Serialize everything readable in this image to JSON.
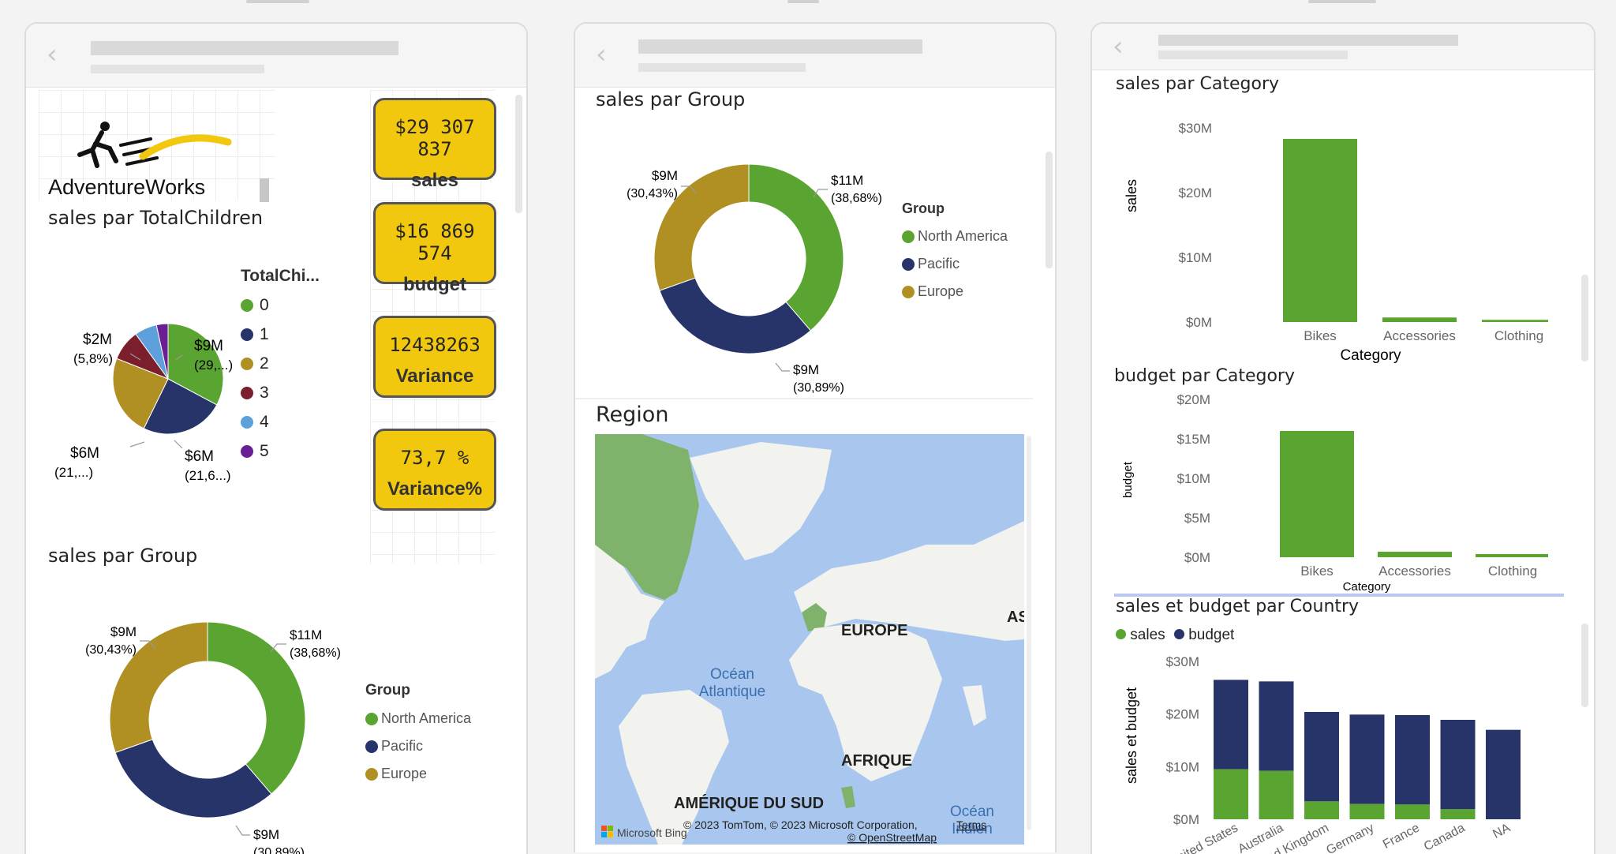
{
  "colors": {
    "north_america": "#5aa532",
    "pacific": "#27346a",
    "europe": "#b09022",
    "dark_red": "#7a1f2b",
    "light_blue": "#5da0dc",
    "purple": "#6b1f94",
    "kpi_yellow": "#f2c80f",
    "map_water": "#a9c7ee",
    "map_land": "#f2f2ee",
    "map_green": "#7fb36c"
  },
  "icons": {
    "back": "chevron-left-icon",
    "logo": "adventureworks-cyclist-logo"
  },
  "panel1": {
    "logo_text": "AdventureWorks",
    "kpis": [
      {
        "value": "$29 307 837",
        "label": "sales"
      },
      {
        "value": "$16 869 574",
        "label": "budget"
      },
      {
        "value": "12438263",
        "label": "Variance"
      },
      {
        "value": "73,7 %",
        "label": "Variance%"
      }
    ],
    "pie_title": "sales par TotalChildren",
    "pie_legend_title": "TotalChi...",
    "pie_legend": [
      "0",
      "1",
      "2",
      "3",
      "4",
      "5"
    ],
    "pie_labels": [
      {
        "v": "$2M",
        "p": "(5,8%)"
      },
      {
        "v": "$9M",
        "p": "(29,...)"
      },
      {
        "v": "$6M",
        "p": "(21,...)"
      },
      {
        "v": "$6M",
        "p": "(21,6...)"
      }
    ],
    "donut_title": "sales par Group"
  },
  "donut": {
    "legend_title": "Group",
    "legend": [
      "North America",
      "Pacific",
      "Europe"
    ],
    "label_na": {
      "v": "$11M",
      "p": "(38,68%)"
    },
    "label_pac": {
      "v": "$9M",
      "p": "(30,89%)"
    },
    "label_eu": {
      "v": "$9M",
      "p": "(30,43%)"
    }
  },
  "panel2": {
    "donut_title": "sales par Group",
    "map_title": "Region",
    "map_labels": {
      "europe": "EUROPE",
      "as": "AS",
      "ocean1": "Océan",
      "ocean2": "Atlantique",
      "africa": "AFRIQUE",
      "sa": "AMÉRIQUE DU SUD",
      "ocean3": "Océan",
      "ocean4": "Indien"
    },
    "map_credit": "© 2023 TomTom, © 2023 Microsoft Corporation,",
    "map_terms": "Terms",
    "map_osm": "© OpenStreetMap",
    "map_bing": "Microsoft Bing"
  },
  "panel3": {
    "chart1_title": "sales par Category",
    "chart1_yticks": [
      "$30M",
      "$20M",
      "$10M",
      "$0M"
    ],
    "chart1_ylabel": "sales",
    "chart1_xlabel": "Category",
    "chart2_title": "budget par Category",
    "chart2_yticks": [
      "$20M",
      "$15M",
      "$10M",
      "$5M",
      "$0M"
    ],
    "chart2_ylabel": "budget",
    "chart2_xlabel": "Category",
    "chart3_title": "sales et budget par Country",
    "chart3_legend": [
      "sales",
      "budget"
    ],
    "chart3_yticks": [
      "$30M",
      "$20M",
      "$10M",
      "$0M"
    ],
    "chart3_ylabel": "sales et budget"
  },
  "chart_data": [
    {
      "type": "pie",
      "title": "sales par TotalChildren",
      "series_names": [
        "0",
        "1",
        "2",
        "3",
        "4",
        "5"
      ],
      "values": [
        29,
        21.6,
        21,
        8,
        5.8,
        3
      ],
      "unit": "%"
    },
    {
      "type": "pie",
      "title": "sales par Group",
      "categories": [
        "North America",
        "Pacific",
        "Europe"
      ],
      "values": [
        38.68,
        30.89,
        30.43
      ],
      "value_labels": [
        "$11M",
        "$9M",
        "$9M"
      ]
    },
    {
      "type": "bar",
      "title": "sales par Category",
      "xlabel": "Category",
      "ylabel": "sales",
      "categories": [
        "Bikes",
        "Accessories",
        "Clothing"
      ],
      "values": [
        28.3,
        0.7,
        0.34
      ],
      "unit": "$M",
      "ylim": [
        0,
        30
      ]
    },
    {
      "type": "bar",
      "title": "budget par Category",
      "xlabel": "Category",
      "ylabel": "budget",
      "categories": [
        "Bikes",
        "Accessories",
        "Clothing"
      ],
      "values": [
        16,
        0.7,
        0.4
      ],
      "unit": "$M",
      "ylim": [
        0,
        20
      ]
    },
    {
      "type": "bar",
      "stacked": true,
      "title": "sales et budget par Country",
      "ylabel": "sales et budget",
      "categories": [
        "United States",
        "Australia",
        "United Kingdom",
        "Germany",
        "France",
        "Canada",
        "NA"
      ],
      "series": [
        {
          "name": "sales",
          "values": [
            9.5,
            9.2,
            3.4,
            2.9,
            2.8,
            1.9,
            0
          ]
        },
        {
          "name": "budget",
          "values": [
            17,
            17,
            17,
            17,
            17,
            17,
            17
          ]
        }
      ],
      "unit": "$M",
      "ylim": [
        0,
        30
      ],
      "legend": "top-left"
    }
  ]
}
